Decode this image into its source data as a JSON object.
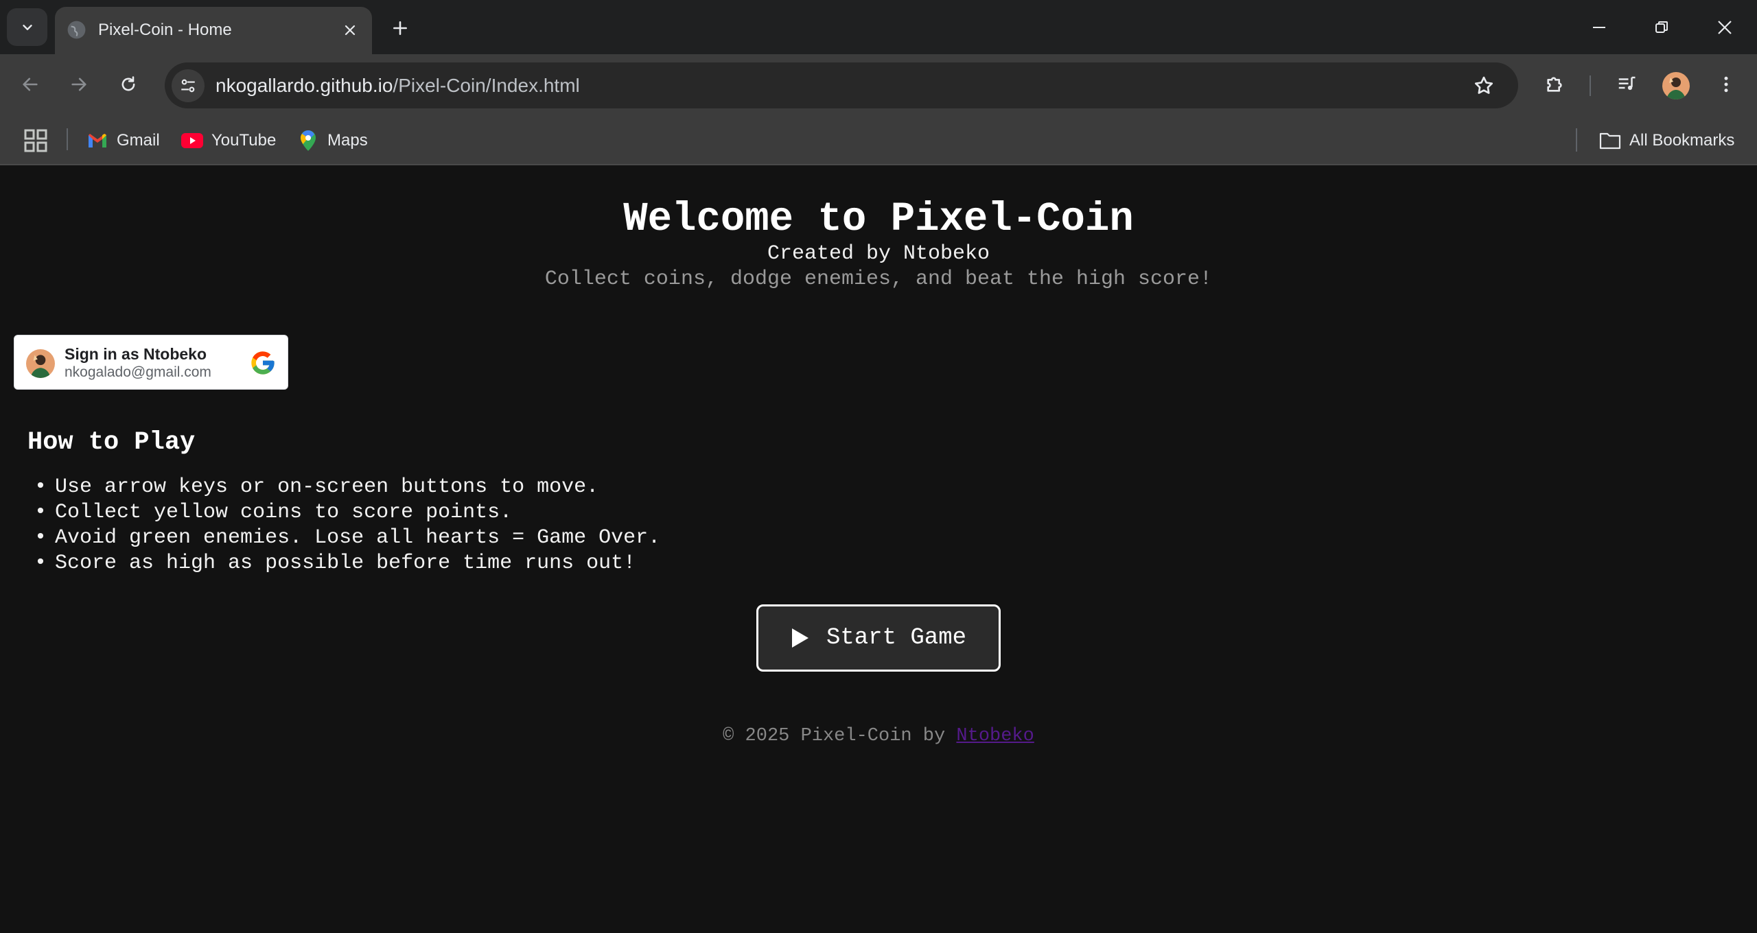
{
  "browser": {
    "tab_title": "Pixel-Coin - Home",
    "url_host": "nkogallardo.github.io",
    "url_path": "/Pixel-Coin/Index.html",
    "bookmarks": [
      {
        "label": "Gmail",
        "icon": "gmail-icon"
      },
      {
        "label": "YouTube",
        "icon": "youtube-icon"
      },
      {
        "label": "Maps",
        "icon": "maps-icon"
      }
    ],
    "all_bookmarks_label": "All Bookmarks"
  },
  "hero": {
    "title": "Welcome to Pixel-Coin",
    "subtitle": "Created by Ntobeko",
    "tagline": "Collect coins, dodge enemies, and beat the high score!"
  },
  "google_signin": {
    "name_line": "Sign in as Ntobeko",
    "email": "nkogalado@gmail.com"
  },
  "how_to_play": {
    "title": "How to Play",
    "items": [
      "Use arrow keys or on-screen buttons to move.",
      "Collect yellow coins to score points.",
      "Avoid green enemies. Lose all hearts = Game Over.",
      "Score as high as possible before time runs out!"
    ]
  },
  "start_button": {
    "label": "Start Game"
  },
  "footer": {
    "prefix": "© 2025 Pixel-Coin by ",
    "author_link": "Ntobeko"
  },
  "colors": {
    "page_background": "#121212",
    "link": "#551a8b",
    "button_border": "#ffffff"
  }
}
